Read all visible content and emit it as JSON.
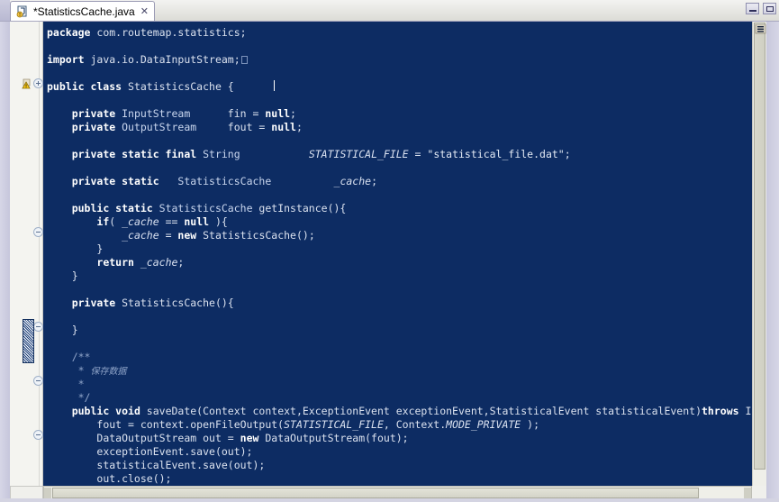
{
  "window": {
    "minimize_label": "Minimize",
    "maximize_label": "Maximize"
  },
  "tab": {
    "title": "*StatisticsCache.java",
    "close_label": "✕",
    "icon": "java-file-icon"
  },
  "gutter": {
    "warning_icon": "warning-marker-icon",
    "fold_collapsed_icon": "+",
    "fold_expanded_icon": "−"
  },
  "editor": {
    "background_color": "#0d2c63",
    "foreground_color": "#dfe4ee",
    "keyword_color": "#ffffff",
    "comment_color": "#8fa4c8",
    "code_lines": [
      {
        "indent": 0,
        "tokens": [
          {
            "t": "kw",
            "v": "package"
          },
          {
            "t": "plain",
            "v": " com.routemap.statistics;"
          }
        ]
      },
      {
        "indent": 0,
        "tokens": []
      },
      {
        "indent": 0,
        "tokens": [
          {
            "t": "kw",
            "v": "import"
          },
          {
            "t": "plain",
            "v": " java.io.DataInputStream;"
          },
          {
            "t": "foldbox",
            "v": ""
          }
        ]
      },
      {
        "indent": 0,
        "tokens": []
      },
      {
        "indent": 0,
        "tokens": [
          {
            "t": "kw",
            "v": "public class"
          },
          {
            "t": "plain",
            "v": " StatisticsCache {"
          }
        ]
      },
      {
        "indent": 0,
        "tokens": []
      },
      {
        "indent": 1,
        "tokens": [
          {
            "t": "kw",
            "v": "private"
          },
          {
            "t": "typ",
            "v": " InputStream      "
          },
          {
            "t": "plain",
            "v": "fin = "
          },
          {
            "t": "kw",
            "v": "null"
          },
          {
            "t": "plain",
            "v": ";"
          }
        ]
      },
      {
        "indent": 1,
        "tokens": [
          {
            "t": "kw",
            "v": "private"
          },
          {
            "t": "typ",
            "v": " OutputStream     "
          },
          {
            "t": "plain",
            "v": "fout = "
          },
          {
            "t": "kw",
            "v": "null"
          },
          {
            "t": "plain",
            "v": ";"
          }
        ]
      },
      {
        "indent": 0,
        "tokens": []
      },
      {
        "indent": 1,
        "tokens": [
          {
            "t": "kw",
            "v": "private static final"
          },
          {
            "t": "typ",
            "v": " String"
          },
          {
            "t": "plain",
            "v": "           "
          },
          {
            "t": "fld",
            "v": "STATISTICAL_FILE"
          },
          {
            "t": "plain",
            "v": " = "
          },
          {
            "t": "str",
            "v": "\"statistical_file.dat\""
          },
          {
            "t": "plain",
            "v": ";"
          }
        ]
      },
      {
        "indent": 0,
        "tokens": []
      },
      {
        "indent": 1,
        "tokens": [
          {
            "t": "kw",
            "v": "private static"
          },
          {
            "t": "typ",
            "v": "   StatisticsCache"
          },
          {
            "t": "plain",
            "v": "          "
          },
          {
            "t": "fld",
            "v": "_cache"
          },
          {
            "t": "plain",
            "v": ";"
          }
        ]
      },
      {
        "indent": 0,
        "tokens": []
      },
      {
        "indent": 1,
        "tokens": [
          {
            "t": "kw",
            "v": "public static"
          },
          {
            "t": "typ",
            "v": " StatisticsCache"
          },
          {
            "t": "plain",
            "v": " getInstance(){"
          }
        ]
      },
      {
        "indent": 2,
        "tokens": [
          {
            "t": "kw",
            "v": "if"
          },
          {
            "t": "plain",
            "v": "( "
          },
          {
            "t": "fld",
            "v": "_cache"
          },
          {
            "t": "plain",
            "v": " == "
          },
          {
            "t": "kw",
            "v": "null"
          },
          {
            "t": "plain",
            "v": " ){"
          }
        ]
      },
      {
        "indent": 3,
        "tokens": [
          {
            "t": "fld",
            "v": "_cache"
          },
          {
            "t": "plain",
            "v": " = "
          },
          {
            "t": "kw",
            "v": "new"
          },
          {
            "t": "plain",
            "v": " StatisticsCache();"
          }
        ]
      },
      {
        "indent": 2,
        "tokens": [
          {
            "t": "plain",
            "v": "}"
          }
        ]
      },
      {
        "indent": 2,
        "tokens": [
          {
            "t": "kw",
            "v": "return"
          },
          {
            "t": "plain",
            "v": " "
          },
          {
            "t": "fld",
            "v": "_cache"
          },
          {
            "t": "plain",
            "v": ";"
          }
        ]
      },
      {
        "indent": 1,
        "tokens": [
          {
            "t": "plain",
            "v": "}"
          }
        ]
      },
      {
        "indent": 0,
        "tokens": []
      },
      {
        "indent": 1,
        "tokens": [
          {
            "t": "kw",
            "v": "private"
          },
          {
            "t": "plain",
            "v": " StatisticsCache(){"
          }
        ]
      },
      {
        "indent": 0,
        "tokens": []
      },
      {
        "indent": 1,
        "tokens": [
          {
            "t": "plain",
            "v": "}"
          }
        ]
      },
      {
        "indent": 0,
        "tokens": []
      },
      {
        "indent": 1,
        "tokens": [
          {
            "t": "cmt",
            "v": "/**"
          }
        ]
      },
      {
        "indent": 1,
        "tokens": [
          {
            "t": "cmt",
            "v": " * "
          },
          {
            "t": "cmtcn",
            "v": "保存数据"
          }
        ]
      },
      {
        "indent": 1,
        "tokens": [
          {
            "t": "cmt",
            "v": " *"
          }
        ]
      },
      {
        "indent": 1,
        "tokens": [
          {
            "t": "cmt",
            "v": " */"
          }
        ]
      },
      {
        "indent": 1,
        "tokens": [
          {
            "t": "kw",
            "v": "public void"
          },
          {
            "t": "plain",
            "v": " saveDate(Context context,ExceptionEvent exceptionEvent,StatisticalEvent statisticalEvent)"
          },
          {
            "t": "kw",
            "v": "throws"
          },
          {
            "t": "plain",
            "v": " IOException{"
          }
        ]
      },
      {
        "indent": 2,
        "tokens": [
          {
            "t": "plain",
            "v": "fout = context.openFileOutput("
          },
          {
            "t": "fld",
            "v": "STATISTICAL_FILE"
          },
          {
            "t": "plain",
            "v": ", Context."
          },
          {
            "t": "fld",
            "v": "MODE_PRIVATE"
          },
          {
            "t": "plain",
            "v": " );"
          }
        ]
      },
      {
        "indent": 2,
        "tokens": [
          {
            "t": "plain",
            "v": "DataOutputStream out = "
          },
          {
            "t": "kw",
            "v": "new"
          },
          {
            "t": "plain",
            "v": " DataOutputStream(fout);"
          }
        ]
      },
      {
        "indent": 2,
        "tokens": [
          {
            "t": "plain",
            "v": "exceptionEvent.save(out);"
          }
        ]
      },
      {
        "indent": 2,
        "tokens": [
          {
            "t": "plain",
            "v": "statisticalEvent.save(out);"
          }
        ]
      },
      {
        "indent": 2,
        "tokens": [
          {
            "t": "plain",
            "v": "out.close();"
          }
        ]
      }
    ]
  },
  "scrollbars": {
    "vertical_label": "vertical-scrollbar",
    "horizontal_label": "horizontal-scrollbar"
  }
}
